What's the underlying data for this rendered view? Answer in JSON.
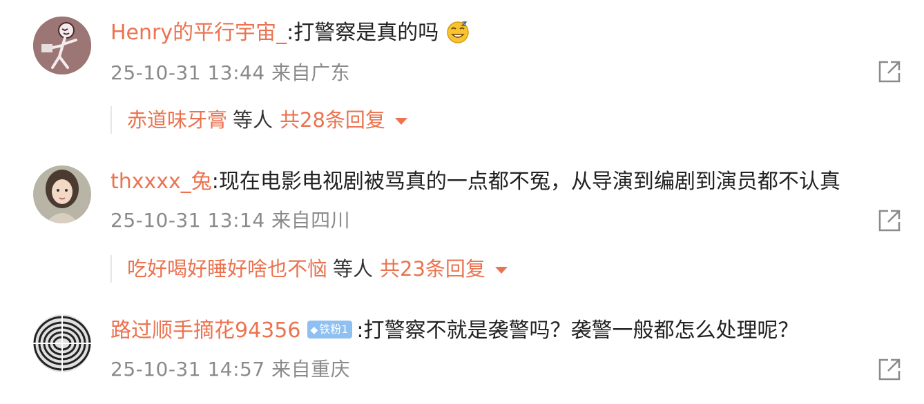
{
  "comments": [
    {
      "username": "Henry的平行宇宙_",
      "text": ":打警察是真的吗",
      "emoji": "sweat-grin-emoji",
      "timestamp": "25-10-31 13:44 来自广东",
      "replies": {
        "who": "赤道味牙膏",
        "etc": "等人",
        "count": "共28条回复"
      }
    },
    {
      "username": "thxxxx_兔",
      "text": ":现在电影电视剧被骂真的一点都不冤，从导演到编剧到演员都不认真",
      "timestamp": "25-10-31 13:14 来自四川",
      "replies": {
        "who": "吃好喝好睡好啥也不恼",
        "etc": "等人",
        "count": "共23条回复"
      }
    },
    {
      "username": "路过顺手摘花94356",
      "badge": "铁粉1",
      "text": ":打警察不就是袭警吗？袭警一般都怎么处理呢？",
      "timestamp": "25-10-31 14:57 来自重庆"
    }
  ],
  "colors": {
    "username": "#eb7350",
    "meta": "#8a8a8a",
    "badge": "#8ec0f2"
  }
}
